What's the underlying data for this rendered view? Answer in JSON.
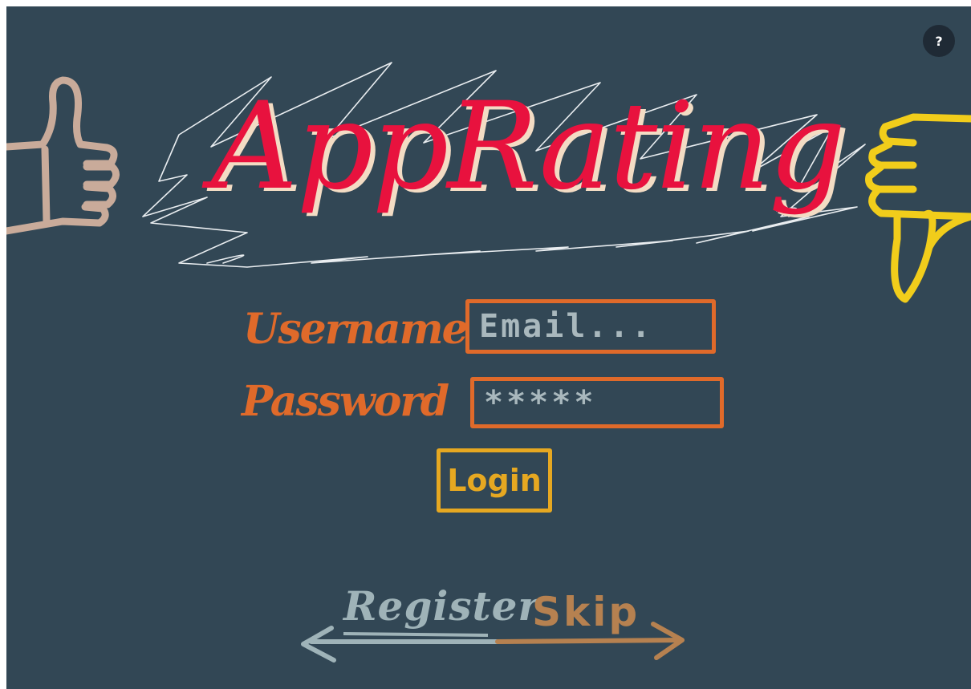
{
  "app": {
    "title": "AppRating"
  },
  "help": {
    "label": "?"
  },
  "login_form": {
    "username_label": "Username",
    "username_placeholder": "Email...",
    "password_label": "Password",
    "password_value": "*****",
    "login_label": "Login"
  },
  "footer": {
    "register_label": "Register",
    "skip_label": "Skip"
  },
  "colors": {
    "background": "#324755",
    "title": "#e8123e",
    "title_shadow": "#f3dcc4",
    "form_accent": "#e06a2a",
    "login_accent": "#e6a821",
    "register": "#9fb3b8",
    "skip": "#b68150",
    "thumbs_up": "#c9ab9a",
    "thumbs_down": "#f1cd1b"
  },
  "icons": {
    "left": "thumbs-up-icon",
    "right": "thumbs-down-icon",
    "help": "question-mark-icon"
  }
}
